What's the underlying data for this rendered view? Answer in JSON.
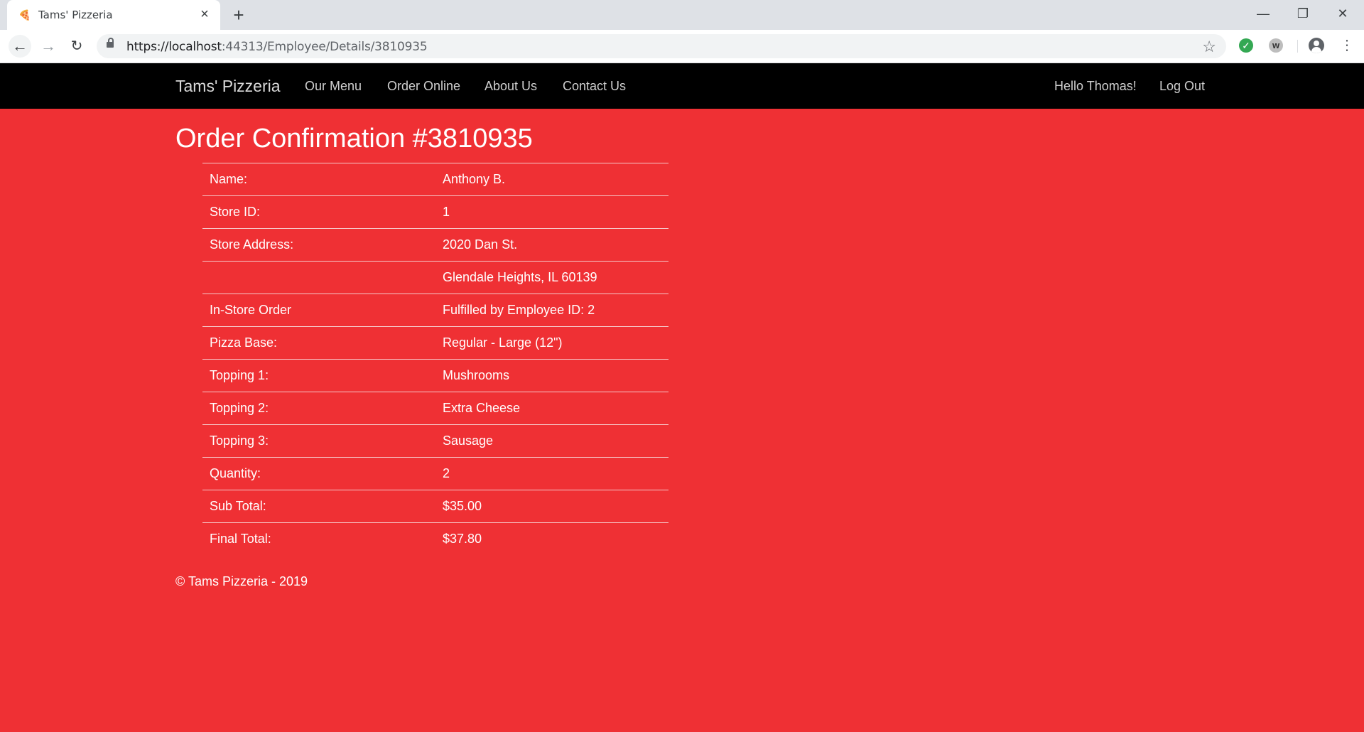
{
  "browser": {
    "tab_title": "Tams' Pizzeria",
    "url_host": "https://localhost",
    "url_rest": ":44313/Employee/Details/3810935"
  },
  "nav": {
    "brand": "Tams' Pizzeria",
    "links": [
      "Our Menu",
      "Order Online",
      "About Us",
      "Contact Us"
    ],
    "greeting": "Hello Thomas!",
    "logout": "Log Out"
  },
  "main": {
    "title": "Order Confirmation #3810935",
    "rows": [
      {
        "label": "Name:",
        "value": "Anthony B."
      },
      {
        "label": "Store ID:",
        "value": "1"
      },
      {
        "label": "Store Address:",
        "value": "2020 Dan St."
      },
      {
        "label": "",
        "value": "Glendale Heights, IL 60139"
      },
      {
        "label": "In-Store Order",
        "value": "Fulfilled by Employee ID: 2"
      },
      {
        "label": "Pizza Base:",
        "value": "Regular - Large (12\")"
      },
      {
        "label": "Topping 1:",
        "value": "Mushrooms"
      },
      {
        "label": "Topping 2:",
        "value": "Extra Cheese"
      },
      {
        "label": "Topping 3:",
        "value": "Sausage"
      },
      {
        "label": "Quantity:",
        "value": "2"
      },
      {
        "label": "Sub Total:",
        "value": "$35.00"
      },
      {
        "label": "Final Total:",
        "value": "$37.80"
      }
    ]
  },
  "footer": {
    "text": "© Tams Pizzeria - 2019"
  }
}
